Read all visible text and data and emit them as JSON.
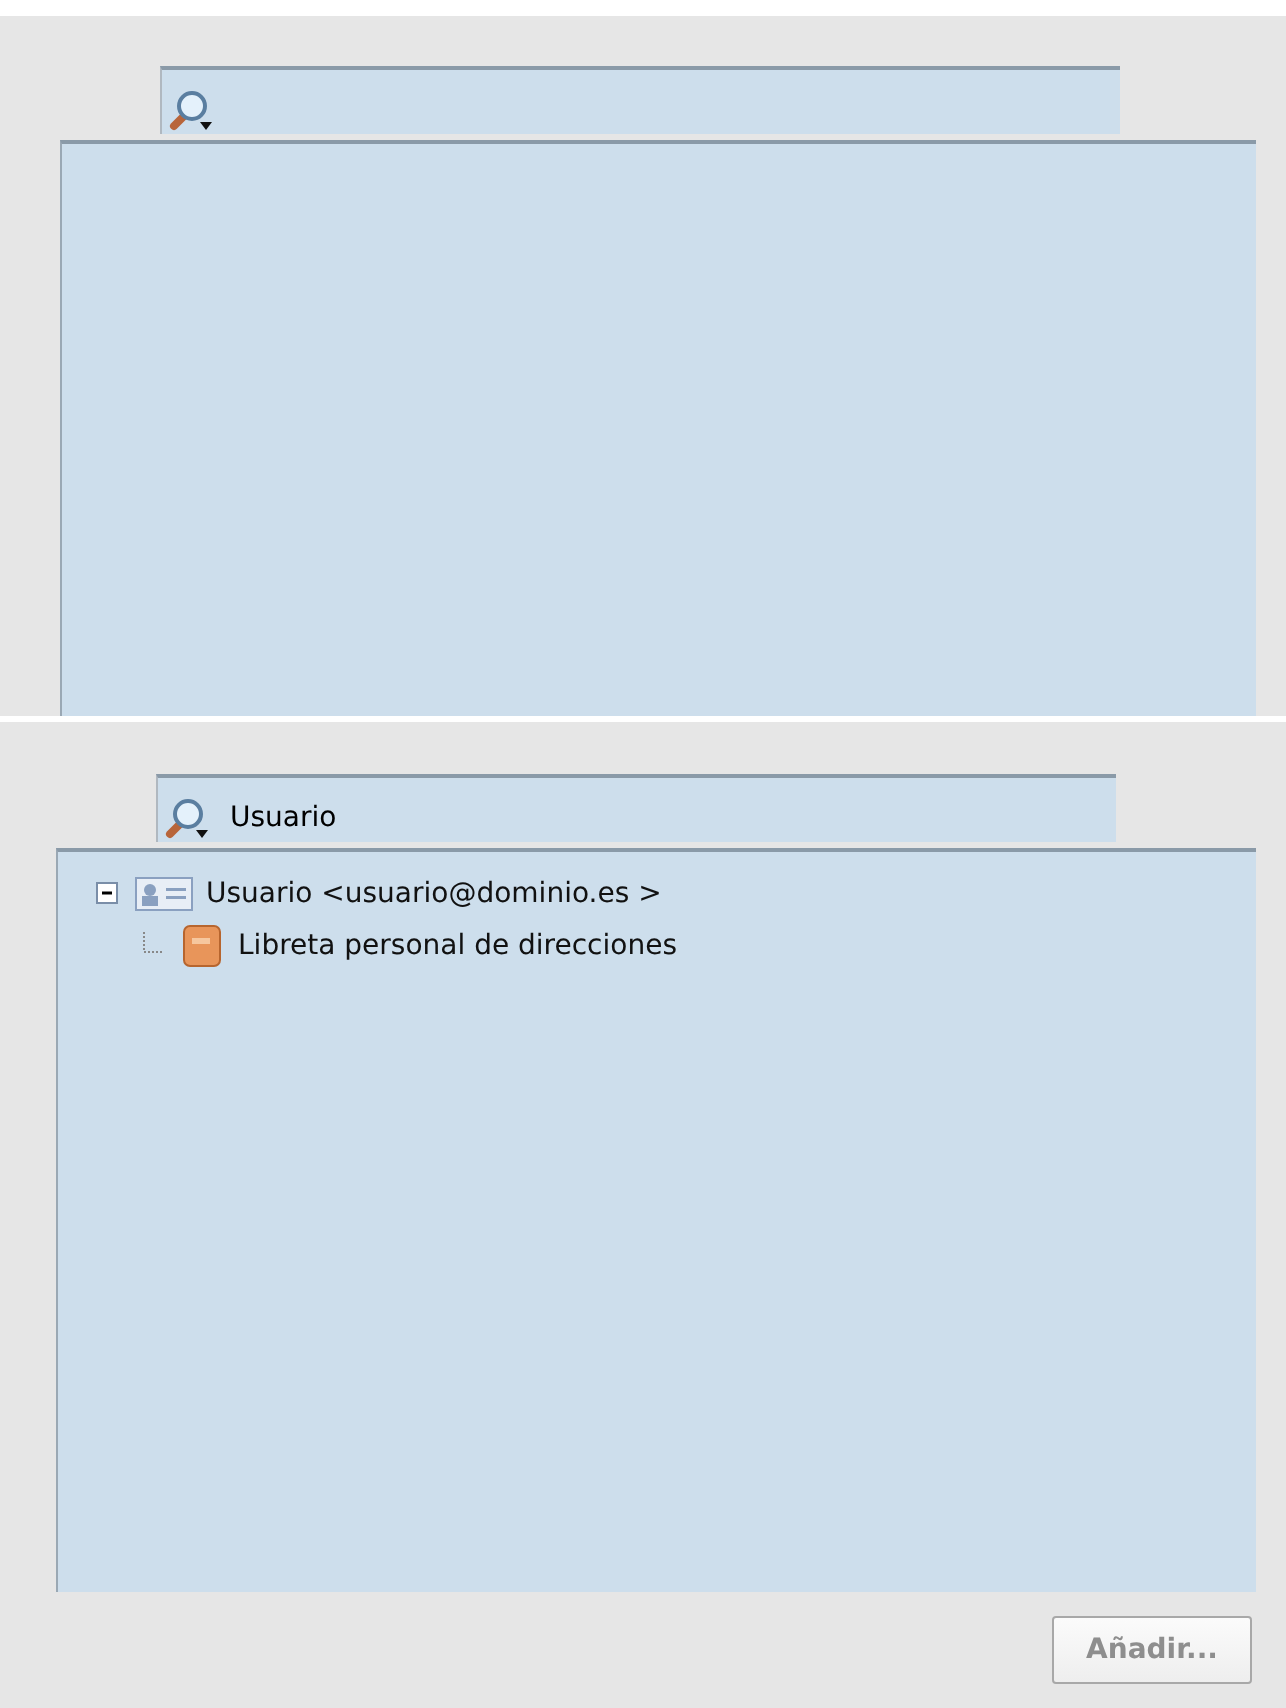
{
  "search": {
    "value": "Usuario"
  },
  "tree": [
    {
      "label": "Usuario <usuario@dominio.es >",
      "kind": "contact",
      "expanded": true,
      "children": [
        {
          "label": "Libreta personal de direcciones",
          "kind": "book"
        }
      ]
    }
  ],
  "button": {
    "label": "Añadir...",
    "disabled": true
  }
}
